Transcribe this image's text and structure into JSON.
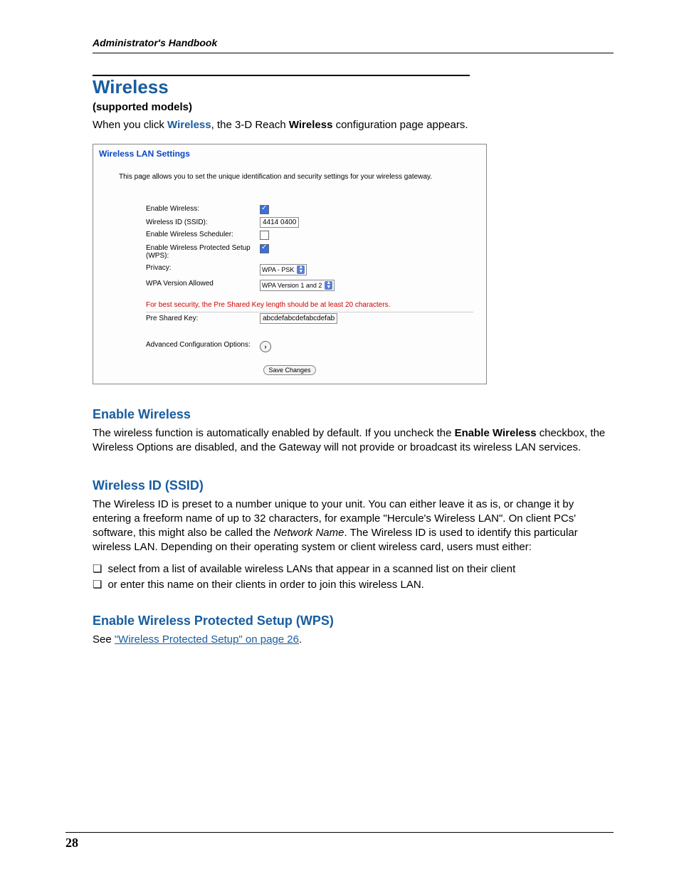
{
  "header": {
    "running_head": "Administrator's Handbook"
  },
  "section": {
    "title": "Wireless",
    "subtitle": "(supported models)",
    "intro_pre": "When you click ",
    "intro_link": "Wireless",
    "intro_mid": ", the 3-D Reach ",
    "intro_bold": "Wireless",
    "intro_post": " configuration page appears."
  },
  "panel": {
    "title": "Wireless LAN Settings",
    "description": "This page allows you to set the unique identification and security settings for your wireless gateway.",
    "fields": {
      "enable_wireless": {
        "label": "Enable Wireless:",
        "checked": true
      },
      "ssid": {
        "label": "Wireless ID (SSID):",
        "value": "4414 0400"
      },
      "scheduler": {
        "label": "Enable Wireless Scheduler:",
        "checked": false
      },
      "wps": {
        "label": "Enable Wireless Protected Setup (WPS):",
        "checked": true
      },
      "privacy": {
        "label": "Privacy:",
        "value": "WPA - PSK"
      },
      "wpa_version": {
        "label": "WPA Version Allowed",
        "value": "WPA Version 1 and 2"
      },
      "warning": "For best security, the Pre Shared Key length should be at least 20 characters.",
      "psk": {
        "label": "Pre Shared Key:",
        "value": "abcdefabcdefabcdefab"
      },
      "advanced": {
        "label": "Advanced Configuration Options:"
      }
    },
    "save_button": "Save Changes"
  },
  "enable_wireless": {
    "heading": "Enable Wireless",
    "text_pre": "The wireless function is automatically enabled by default. If you uncheck the ",
    "text_bold": "Enable Wireless",
    "text_post": " checkbox, the Wireless Options are disabled, and the Gateway will not provide or broadcast its wireless LAN services."
  },
  "ssid_section": {
    "heading": "Wireless ID (SSID)",
    "p1_pre": "The Wireless ID is preset to a number unique to your unit. You can either leave it as is, or change it by entering a freeform name of up to 32 characters, for example \"Hercule's Wireless LAN\". On client PCs' software, this might also be called the ",
    "p1_italic": "Network Name",
    "p1_post": ". The Wireless ID is used to identify this particular wireless LAN. Depending on their operating system or client wireless card, users must either:",
    "bullets": [
      "select from a list of available wireless LANs that appear in a scanned list on their client",
      "or enter this name on their clients in order to join this wireless LAN."
    ]
  },
  "wps_section": {
    "heading": "Enable Wireless Protected Setup (WPS)",
    "see_pre": "See ",
    "see_link": "\"Wireless Protected Setup\" on page 26",
    "see_post": "."
  },
  "page_number": "28"
}
